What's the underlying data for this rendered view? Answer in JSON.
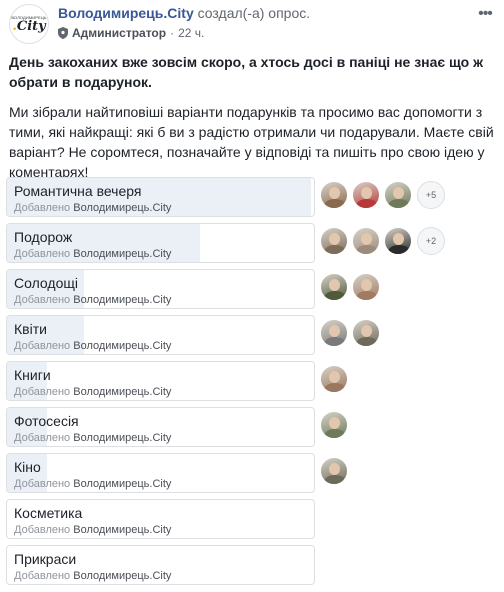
{
  "header": {
    "logo_small": "ВОЛОДИМИРЕЦЬ",
    "logo_big": "City",
    "page_name": "Володимирець.City",
    "action_text": "создал(-а) опрос.",
    "role": "Администратор",
    "dot": "·",
    "time": "22 ч.",
    "more": "•••"
  },
  "post": {
    "lead": "День закоханих вже зовсім скоро, а хтось досі в паніці не знає що ж обрати в подарунок.",
    "body": "Ми зібрали найтиповіші варіанти подарунків та просимо вас допомогти з тими, які найкращі: які б ви з радістю отримали чи подарували. Маєте свій варіант? Не соромтеся, позначайте у відповіді та пишіть про свою ідею у коментарях!"
  },
  "poll": {
    "added_by_label": "Добавлено",
    "added_by_name": "Володимирець.City",
    "options": [
      {
        "label": "Романтична вечеря",
        "fill": 0.99,
        "voters": [
          "#8a6a4e",
          "#b63a3a",
          "#6f7a5c"
        ],
        "more": "+5"
      },
      {
        "label": "Подорож",
        "fill": 0.63,
        "voters": [
          "#7d6c5a",
          "#9c8b7b",
          "#2a2a2a"
        ],
        "more": "+2"
      },
      {
        "label": "Солодощі",
        "fill": 0.25,
        "voters": [
          "#4e5a3a",
          "#a07a62"
        ],
        "more": ""
      },
      {
        "label": "Квіти",
        "fill": 0.25,
        "voters": [
          "#7a7a7a",
          "#6e6a5a"
        ],
        "more": ""
      },
      {
        "label": "Книги",
        "fill": 0.13,
        "voters": [
          "#9a7760"
        ],
        "more": ""
      },
      {
        "label": "Фотосесія",
        "fill": 0.13,
        "voters": [
          "#6f7a5c"
        ],
        "more": ""
      },
      {
        "label": "Кіно",
        "fill": 0.13,
        "voters": [
          "#6e6a5a"
        ],
        "more": ""
      },
      {
        "label": "Косметика",
        "fill": 0.0,
        "voters": [],
        "more": ""
      },
      {
        "label": "Прикраси",
        "fill": 0.0,
        "voters": [],
        "more": ""
      }
    ]
  },
  "colors": {
    "link": "#385898",
    "fill": "#ebeff6",
    "border": "#dddfe2",
    "muted": "#90949c"
  }
}
